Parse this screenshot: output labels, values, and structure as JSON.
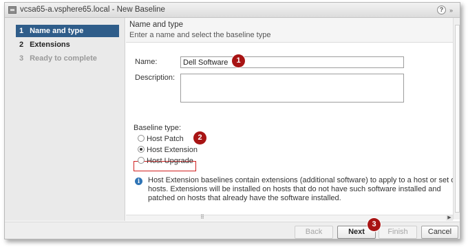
{
  "window": {
    "title": "vcsa65-a.vsphere65.local - New Baseline",
    "help_label": "?",
    "expand_label": "»"
  },
  "sidebar": {
    "steps": [
      {
        "num": "1",
        "label": "Name and type",
        "state": "active"
      },
      {
        "num": "2",
        "label": "Extensions",
        "state": "normal"
      },
      {
        "num": "3",
        "label": "Ready to complete",
        "state": "disabled"
      }
    ]
  },
  "header": {
    "title": "Name and type",
    "subtitle": "Enter a name and select the baseline type"
  },
  "form": {
    "name_label": "Name:",
    "name_value": "Dell Software",
    "description_label": "Description:",
    "description_value": "",
    "baseline_type_label": "Baseline type:",
    "baseline_options": [
      {
        "label": "Host Patch",
        "checked": false
      },
      {
        "label": "Host Extension",
        "checked": true
      },
      {
        "label": "Host Upgrade",
        "checked": false
      }
    ]
  },
  "info": {
    "icon": "info-icon",
    "text": "Host Extension baselines contain extensions (additional software) to apply to a host or set of hosts. Extensions will be installed on hosts that do not have such software installed and patched on hosts that already have the software installed."
  },
  "footer": {
    "back_label": "Back",
    "next_label": "Next",
    "finish_label": "Finish",
    "cancel_label": "Cancel"
  },
  "callouts": {
    "one": "1",
    "two": "2",
    "three": "3",
    "color": "#a81414"
  },
  "colors": {
    "active_step": "#2f5d8a",
    "highlight_box": "#d01e1e",
    "info_icon": "#2f74b5"
  }
}
